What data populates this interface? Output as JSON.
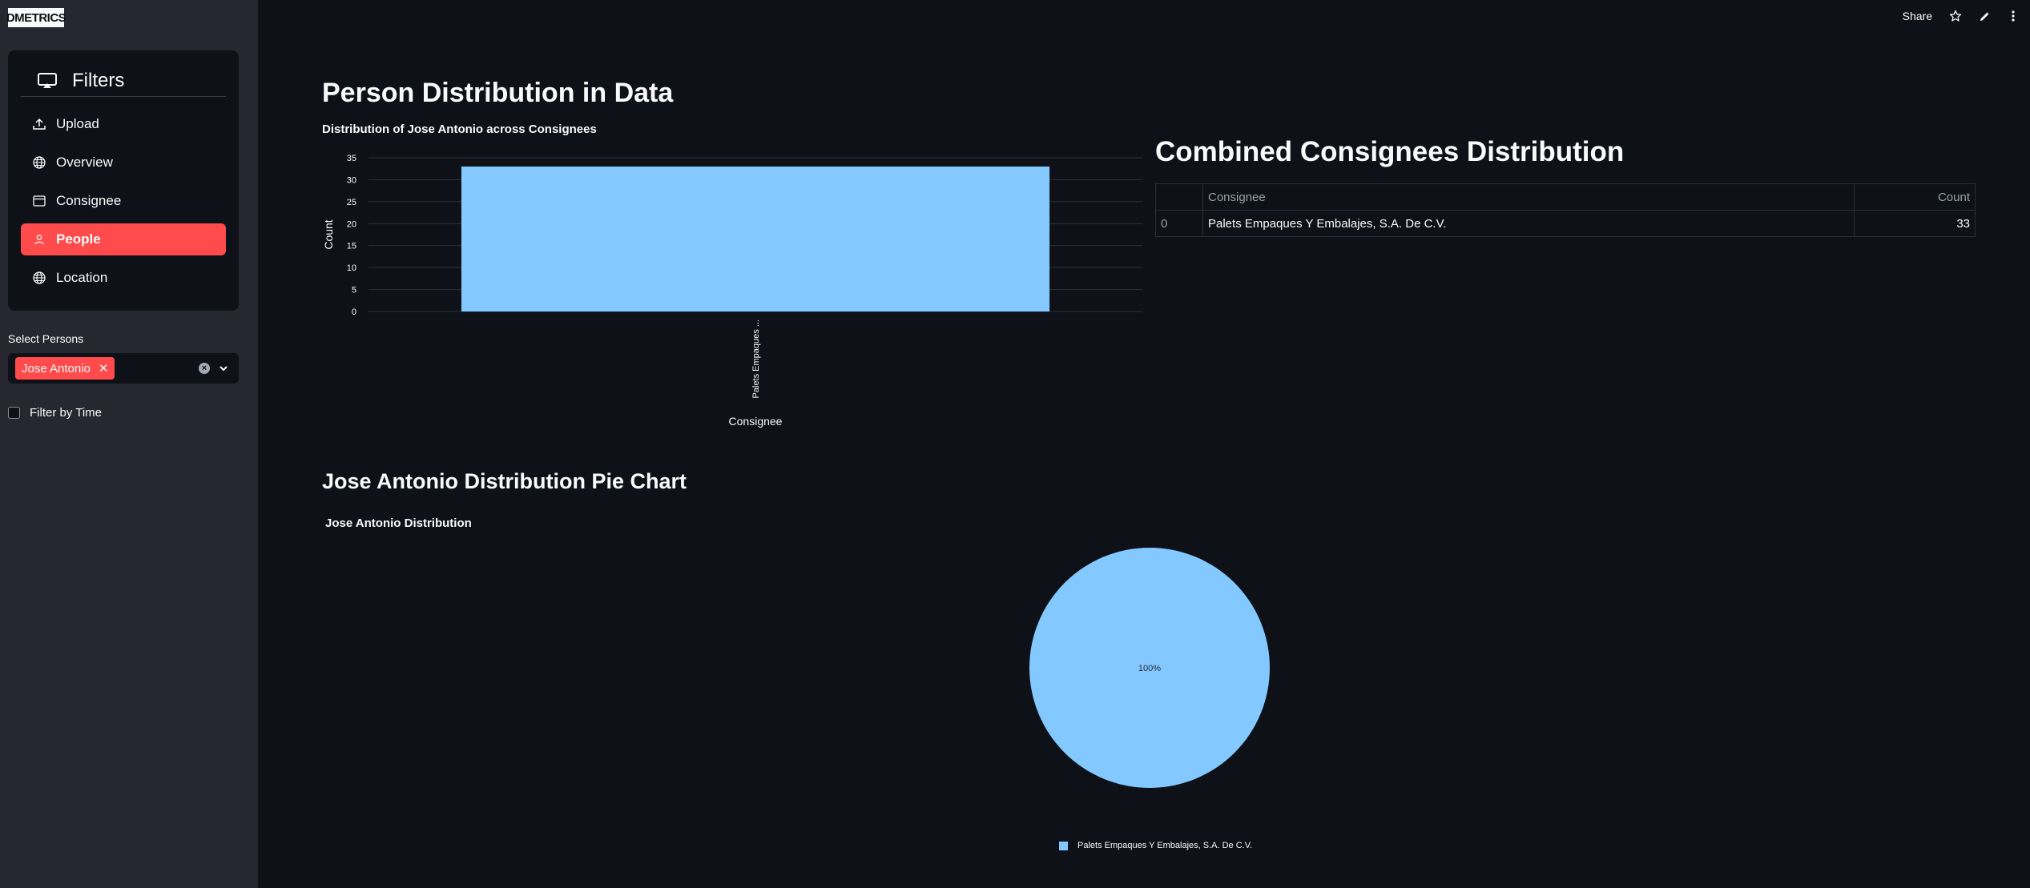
{
  "app": {
    "logo_text": "DMETRICS"
  },
  "toolbar": {
    "share_label": "Share"
  },
  "sidebar": {
    "menu_title": "Filters",
    "items": [
      {
        "label": "Upload",
        "icon": "upload-icon",
        "active": false
      },
      {
        "label": "Overview",
        "icon": "globe-icon",
        "active": false
      },
      {
        "label": "Consignee",
        "icon": "window-icon",
        "active": false
      },
      {
        "label": "People",
        "icon": "person-icon",
        "active": true
      },
      {
        "label": "Location",
        "icon": "globe-icon",
        "active": false
      }
    ],
    "select_persons_label": "Select Persons",
    "selected_person": "Jose Antonio",
    "filter_time_label": "Filter by Time",
    "filter_time_checked": false
  },
  "main": {
    "title": "Person Distribution in Data",
    "bar_chart_title": "Distribution of Jose Antonio across Consignees",
    "combined_title": "Combined Consignees Distribution",
    "table": {
      "headers": [
        "",
        "Consignee",
        "Count"
      ],
      "rows": [
        [
          "0",
          "Palets Empaques Y Embalajes, S.A. De C.V.",
          "33"
        ]
      ]
    },
    "pie_section_title": "Jose Antonio Distribution Pie Chart",
    "pie_chart_title": "Jose Antonio Distribution"
  },
  "colors": {
    "accent": "#ff4b4b",
    "bar": "#83c9ff",
    "background": "#0e1117",
    "sidebar": "#262730"
  },
  "chart_data": [
    {
      "type": "bar",
      "title": "Distribution of Jose Antonio across Consignees",
      "xlabel": "Consignee",
      "ylabel": "Count",
      "categories": [
        "Palets Empaques ..."
      ],
      "values": [
        33
      ],
      "ylim": [
        0,
        35
      ],
      "yticks": [
        0,
        5,
        10,
        15,
        20,
        25,
        30,
        35
      ],
      "grid": true
    },
    {
      "type": "pie",
      "title": "Jose Antonio Distribution",
      "labels": [
        "Palets Empaques Y Embalajes, S.A. De C.V."
      ],
      "values": [
        33
      ],
      "slice_labels": [
        "100%"
      ],
      "legend": "bottom"
    }
  ]
}
